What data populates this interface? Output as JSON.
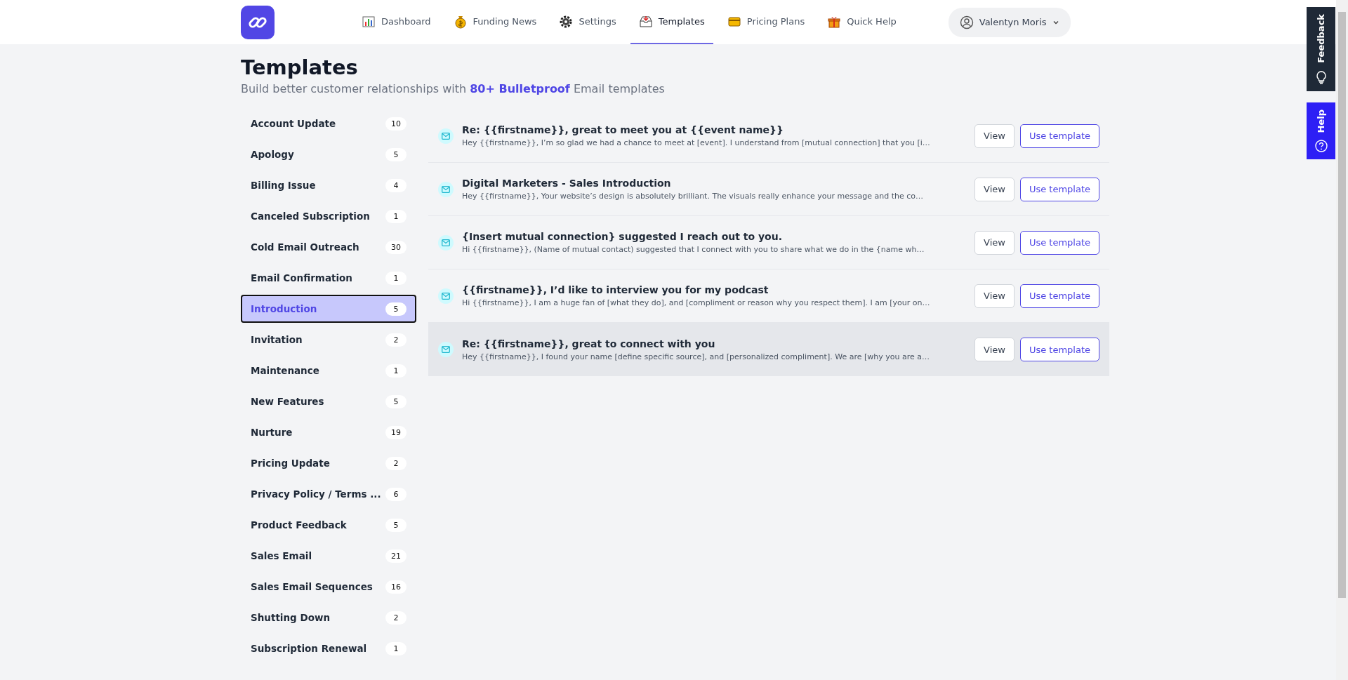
{
  "header": {
    "nav": [
      {
        "label": "Dashboard",
        "selected": false
      },
      {
        "label": "Funding News",
        "selected": false
      },
      {
        "label": "Settings",
        "selected": false
      },
      {
        "label": "Templates",
        "selected": true
      },
      {
        "label": "Pricing Plans",
        "selected": false
      },
      {
        "label": "Quick Help",
        "selected": false
      }
    ],
    "user": {
      "name": "Valentyn Moris"
    }
  },
  "page": {
    "title": "Templates",
    "subtitle": "Build better customer relationships with **80+ Bulletproof** Email templates"
  },
  "categories": [
    {
      "label": "Account Update",
      "count": "10",
      "selected": false
    },
    {
      "label": "Apology",
      "count": "5",
      "selected": false
    },
    {
      "label": "Billing Issue",
      "count": "4",
      "selected": false
    },
    {
      "label": "Canceled Subscription",
      "count": "1",
      "selected": false
    },
    {
      "label": "Cold Email Outreach",
      "count": "30",
      "selected": false
    },
    {
      "label": "Email Confirmation",
      "count": "1",
      "selected": false
    },
    {
      "label": "Introduction",
      "count": "5",
      "selected": true
    },
    {
      "label": "Invitation",
      "count": "2",
      "selected": false
    },
    {
      "label": "Maintenance",
      "count": "1",
      "selected": false
    },
    {
      "label": "New Features",
      "count": "5",
      "selected": false
    },
    {
      "label": "Nurture",
      "count": "19",
      "selected": false
    },
    {
      "label": "Pricing Update",
      "count": "2",
      "selected": false
    },
    {
      "label": "Privacy Policy / Terms ...",
      "count": "6",
      "selected": false
    },
    {
      "label": "Product Feedback",
      "count": "5",
      "selected": false
    },
    {
      "label": "Sales Email",
      "count": "21",
      "selected": false
    },
    {
      "label": "Sales Email Sequences",
      "count": "16",
      "selected": false
    },
    {
      "label": "Shutting Down",
      "count": "2",
      "selected": false
    },
    {
      "label": "Subscription Renewal",
      "count": "1",
      "selected": false
    }
  ],
  "templates": [
    {
      "title": "Re: {{firstname}}, great to meet you at {{event name}}",
      "snippet": "Hey {{firstname}}, I’m so glad we had a chance to meet at [event]. I understand from [mutual connection] that you [i…",
      "highlighted": false,
      "view": "View",
      "use": "Use template"
    },
    {
      "title": "Digital Marketers - Sales Introduction",
      "snippet": "Hey {{firstname}}, Your website’s design is absolutely brilliant. The visuals really enhance your message and the co…",
      "highlighted": false,
      "view": "View",
      "use": "Use template"
    },
    {
      "title": "{Insert mutual connection} suggested I reach out to you.",
      "snippet": "Hi {{firstname}}, (Name of mutual contact) suggested that I connect with you to share what we do in the {name wh…",
      "highlighted": false,
      "view": "View",
      "use": "Use template"
    },
    {
      "title": "{{firstname}}, I’d like to interview you for my podcast",
      "snippet": "Hi {{firstname}}, I am a huge fan of [what they do], and [compliment or reason why you respect them]. I am [your on…",
      "highlighted": false,
      "view": "View",
      "use": "Use template"
    },
    {
      "title": "Re: {{firstname}}, great to connect with you",
      "snippet": "Hey {{firstname}}, I found your name [define specific source], and [personalized compliment]. We are [why you are a…",
      "highlighted": true,
      "view": "View",
      "use": "Use template"
    }
  ],
  "side_tabs": [
    {
      "label": "Feedback",
      "kind": "feedback"
    },
    {
      "label": "Help",
      "kind": "help"
    }
  ]
}
